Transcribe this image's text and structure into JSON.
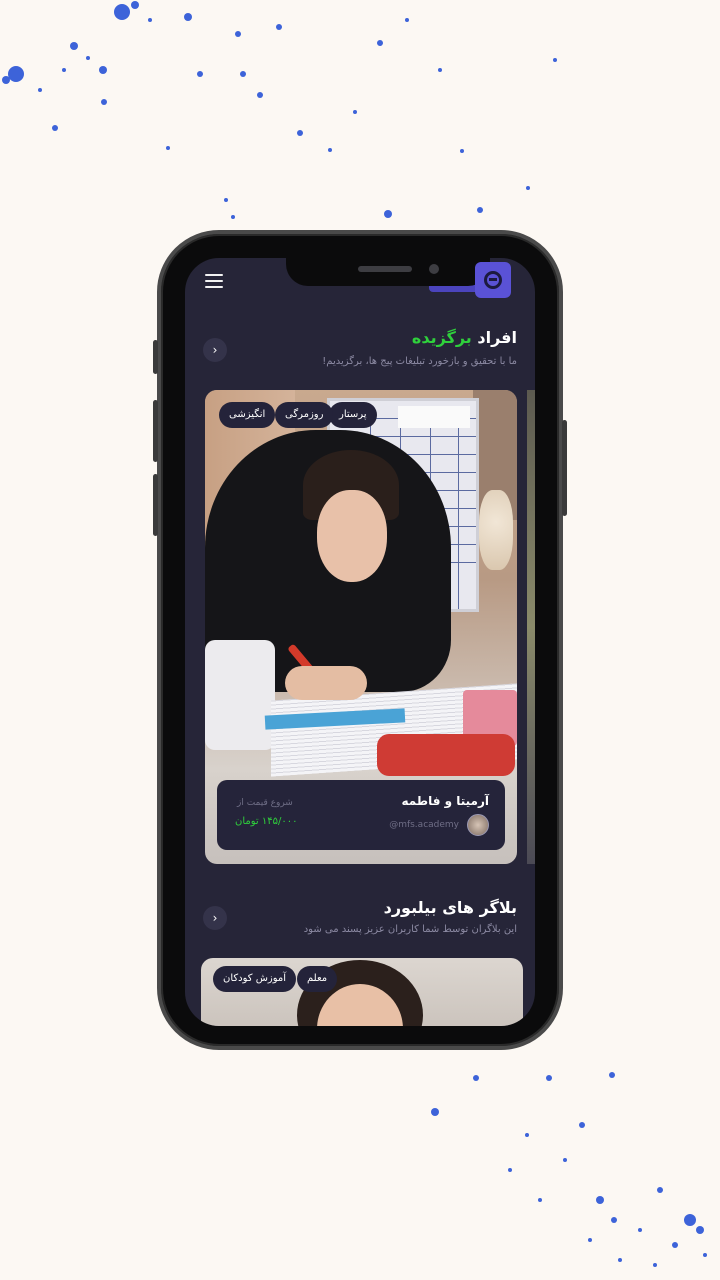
{
  "header": {
    "menu_icon": "hamburger-icon",
    "logo_icon": "brand-logo-icon"
  },
  "featured": {
    "title_prefix": "افراد",
    "title_accent": "برگزیده",
    "subtitle": "ما با تحقیق و بازخورد تبلیغات پیج ها، برگزیدیم!",
    "arrow": "›",
    "card": {
      "tags": [
        "پرستار",
        "روزمرگی",
        "انگیزشی"
      ],
      "name": "آرمیتا و فاطمه",
      "handle": "@mfs.academy",
      "start_label": "شروع قیمت از",
      "price": "۱۴۵/۰۰۰ تومان"
    }
  },
  "billboard": {
    "title": "بلاگر های بیلبورد",
    "subtitle": "این بلاگران توسط شما کاربران عزیز پسند می شود",
    "arrow": "›",
    "card": {
      "tags": [
        "معلم",
        "آموزش کودکان"
      ]
    }
  },
  "colors": {
    "background": "#fcf8f3",
    "screen": "#262538",
    "accent_green": "#2fd03c",
    "brand_purple": "#5a52d6",
    "splatter_blue": "#3d63d9"
  }
}
